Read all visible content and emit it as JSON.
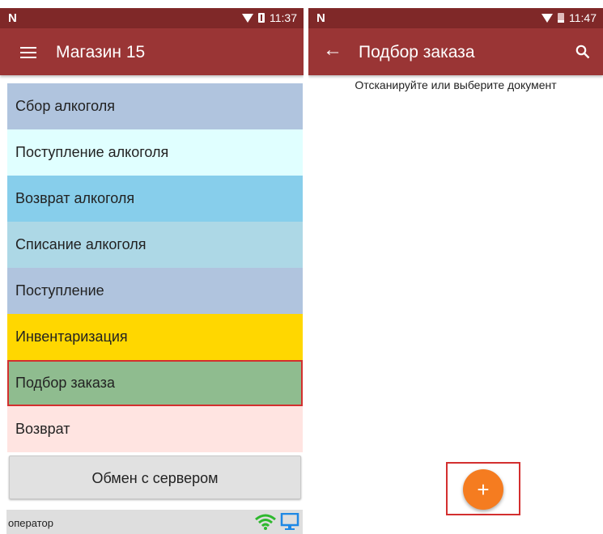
{
  "left": {
    "status": {
      "logo": "N",
      "time": "11:37"
    },
    "appbar": {
      "title": "Магазин 15"
    },
    "menu": [
      {
        "label": "Сбор алкоголя",
        "color": "#b0c4de"
      },
      {
        "label": "Поступление алкоголя",
        "color": "#e0ffff"
      },
      {
        "label": "Возврат алкоголя",
        "color": "#87ceeb"
      },
      {
        "label": "Списание алкоголя",
        "color": "#add8e6"
      },
      {
        "label": "Поступление",
        "color": "#b0c4de"
      },
      {
        "label": "Инвентаризация",
        "color": "#ffd700"
      },
      {
        "label": "Подбор заказа",
        "color": "#8fbc8f",
        "selected": true
      },
      {
        "label": "Возврат",
        "color": "#ffe4e1"
      }
    ],
    "server_button": "Обмен с сервером",
    "footer": {
      "operator": "оператор",
      "wifi_color": "#2eb82e",
      "monitor_color": "#1e88e5"
    }
  },
  "right": {
    "status": {
      "logo": "N",
      "time": "11:47"
    },
    "appbar": {
      "title": "Подбор заказа",
      "back": "←"
    },
    "prompt": "Отсканируйте или выберите документ",
    "fab": {
      "label": "+",
      "color": "#f57c20"
    }
  },
  "colors": {
    "statusbar": "#7f2828",
    "appbar": "#9a3535",
    "highlight": "#d32f2f"
  },
  "icons": [
    "wifi-icon",
    "battery-icon",
    "menu-icon",
    "back-arrow-icon",
    "search-icon",
    "monitor-icon",
    "add-icon"
  ]
}
